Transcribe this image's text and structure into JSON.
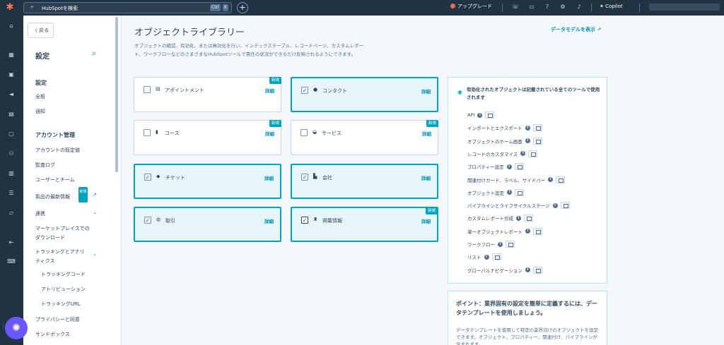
{
  "topbar": {
    "logo_icon": "hubspot-sprocket-icon",
    "search_placeholder": "HubSpotを検索",
    "kbd_ctrl": "Ctrl",
    "kbd_k": "K",
    "plus_icon": "plus-icon",
    "upgrade_label": "アップグレード",
    "copilot_label": "Copilot"
  },
  "sidebar": {
    "back_label": "〈 戻る",
    "title": "設定",
    "sections": {
      "settings_header": "設定",
      "general": "全般",
      "notifications": "通知",
      "account_header": "アカウント管理",
      "account_defaults": "アカウントの既定値",
      "audit_log": "監査ログ",
      "users_teams": "ユーザーとチーム",
      "product_updates": "製品の最新情報",
      "new_badge": "新規",
      "integrations": "連携",
      "marketplace_1": "マーケットプレイスでの",
      "marketplace_2": "ダウンロード",
      "tracking_1": "トラッキングとアナリ",
      "tracking_2": "ティクス",
      "tracking_code": "トラッキングコード",
      "attribution": "アトリビューション",
      "tracking_url": "トラッキングURL",
      "privacy": "プライバシーと同意",
      "sandbox": "サンドボックス"
    }
  },
  "main": {
    "title": "オブジェクトライブラリー",
    "data_model_link": "データモデルを表示",
    "description": "オブジェクトの確認、有効化、または無効化を行い、インデックステーブル、レコードページ、カスタムレポート、ワークフローなどのさまざまなHubSpotツールで責任の状況ができるだけ反映されるようにできます。",
    "details_label": "詳細",
    "new_label": "新規",
    "objects": [
      {
        "name": "アポイントメント",
        "checked": false,
        "selected": false,
        "is_new": true,
        "icon": "calendar-icon"
      },
      {
        "name": "コンタクト",
        "checked": true,
        "selected": true,
        "is_new": false,
        "icon": "person-icon"
      },
      {
        "name": "コース",
        "checked": false,
        "selected": false,
        "is_new": true,
        "icon": "book-icon"
      },
      {
        "name": "サービス",
        "checked": false,
        "selected": false,
        "is_new": true,
        "icon": "service-icon"
      },
      {
        "name": "チケット",
        "checked": true,
        "selected": true,
        "is_new": false,
        "icon": "ticket-icon"
      },
      {
        "name": "会社",
        "checked": true,
        "selected": true,
        "is_new": false,
        "icon": "building-icon"
      },
      {
        "name": "取引",
        "checked": true,
        "selected": true,
        "is_new": false,
        "icon": "handshake-icon"
      },
      {
        "name": "掲載情報",
        "checked": true,
        "selected": true,
        "is_new": true,
        "icon": "listing-icon"
      }
    ]
  },
  "panel": {
    "header": "有効化されたオブジェクトは記載されている全てのツールで使用されます",
    "tools": [
      "API",
      "インポートとエクスポート",
      "オブジェクトのホーム画面",
      "レコードのカスタマイズ",
      "プロパティー設定",
      "関連付けカード、ラベル、サイドバー",
      "オブジェクト設定",
      "パイプラインとライフサイクルステージ",
      "カスタムレポート作成",
      "単一オブジェクトレポート",
      "ワークフロー",
      "リスト",
      "グローバルナビゲーション"
    ]
  },
  "tip": {
    "title": "ポイント：業界固有の設定を簡単に定義するには、データテンプレートを使用しましょう。",
    "description": "データテンプレートを使用して特定の業界向けのオブジェクトを設定できます。オブジェクト、プロパティー、関連付け、パイプラインが含まれます。"
  }
}
